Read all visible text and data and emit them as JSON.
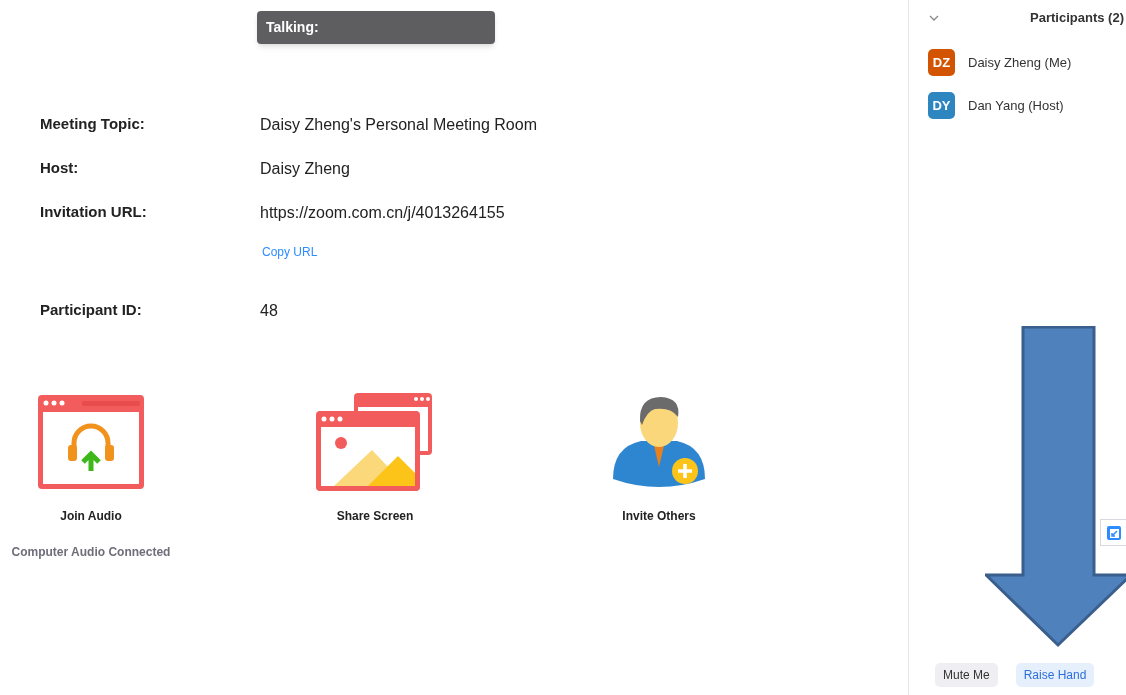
{
  "talking_banner": {
    "label": "Talking:"
  },
  "meeting_info": [
    {
      "label": "Meeting Topic:",
      "value": "Daisy Zheng's Personal Meeting Room"
    },
    {
      "label": "Host:",
      "value": "Daisy Zheng"
    },
    {
      "label": "Invitation URL:",
      "value": "https://zoom.com.cn/j/4013264155",
      "link": "Copy URL"
    },
    {
      "label": "Participant ID:",
      "value": "48"
    }
  ],
  "actions": [
    {
      "kind": "audio",
      "label": "Join Audio",
      "status": "Computer Audio Connected"
    },
    {
      "kind": "share",
      "label": "Share Screen"
    },
    {
      "kind": "invite",
      "label": "Invite Others"
    }
  ],
  "participants_panel": {
    "title": "Participants (2)",
    "expanded": true,
    "participants": [
      {
        "initials": "DZ",
        "name": "Daisy Zheng (Me)",
        "color": "#d35400"
      },
      {
        "initials": "DY",
        "name": "Dan Yang (Host)",
        "color": "#2e86c1"
      }
    ],
    "buttons": [
      {
        "kind": "plain",
        "label": "Mute Me"
      },
      {
        "kind": "accent",
        "label": "Raise Hand"
      }
    ]
  }
}
